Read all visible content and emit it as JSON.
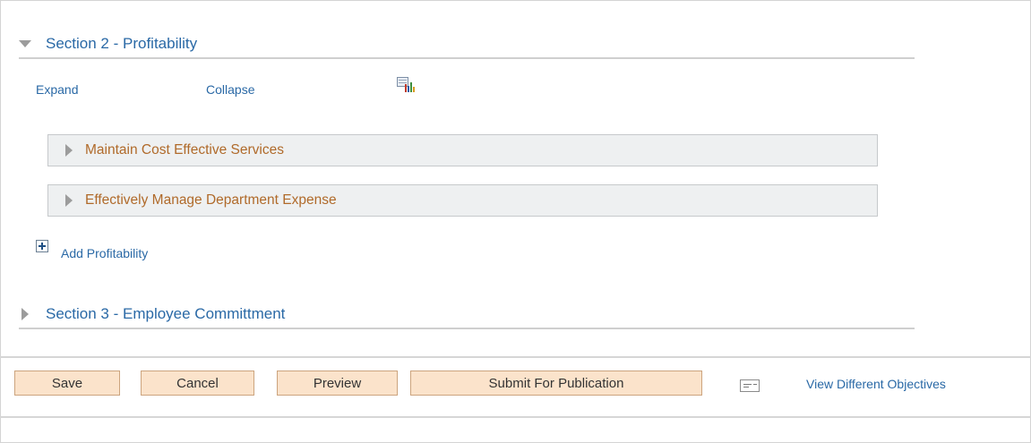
{
  "section2": {
    "title": "Section 2 - Profitability",
    "expanded": true
  },
  "controls": {
    "expand_label": "Expand",
    "collapse_label": "Collapse"
  },
  "objectives": [
    {
      "label": "Maintain Cost Effective Services"
    },
    {
      "label": "Effectively Manage Department Expense"
    }
  ],
  "add_link": {
    "label": "Add Profitability"
  },
  "section3": {
    "title": "Section 3 - Employee Committment",
    "expanded": false
  },
  "footer": {
    "save_label": "Save",
    "cancel_label": "Cancel",
    "preview_label": "Preview",
    "submit_label": "Submit For Publication",
    "view_link_label": "View Different Objectives"
  },
  "colors": {
    "link": "#2a69a6",
    "objective_text": "#b06a2a",
    "button_bg": "#fbe3cb",
    "button_border": "#cca47e",
    "row_bg": "#eef0f1"
  },
  "icons": [
    "triangle-down-icon",
    "triangle-right-icon",
    "chart-icon",
    "add-plus-icon",
    "card-icon"
  ]
}
